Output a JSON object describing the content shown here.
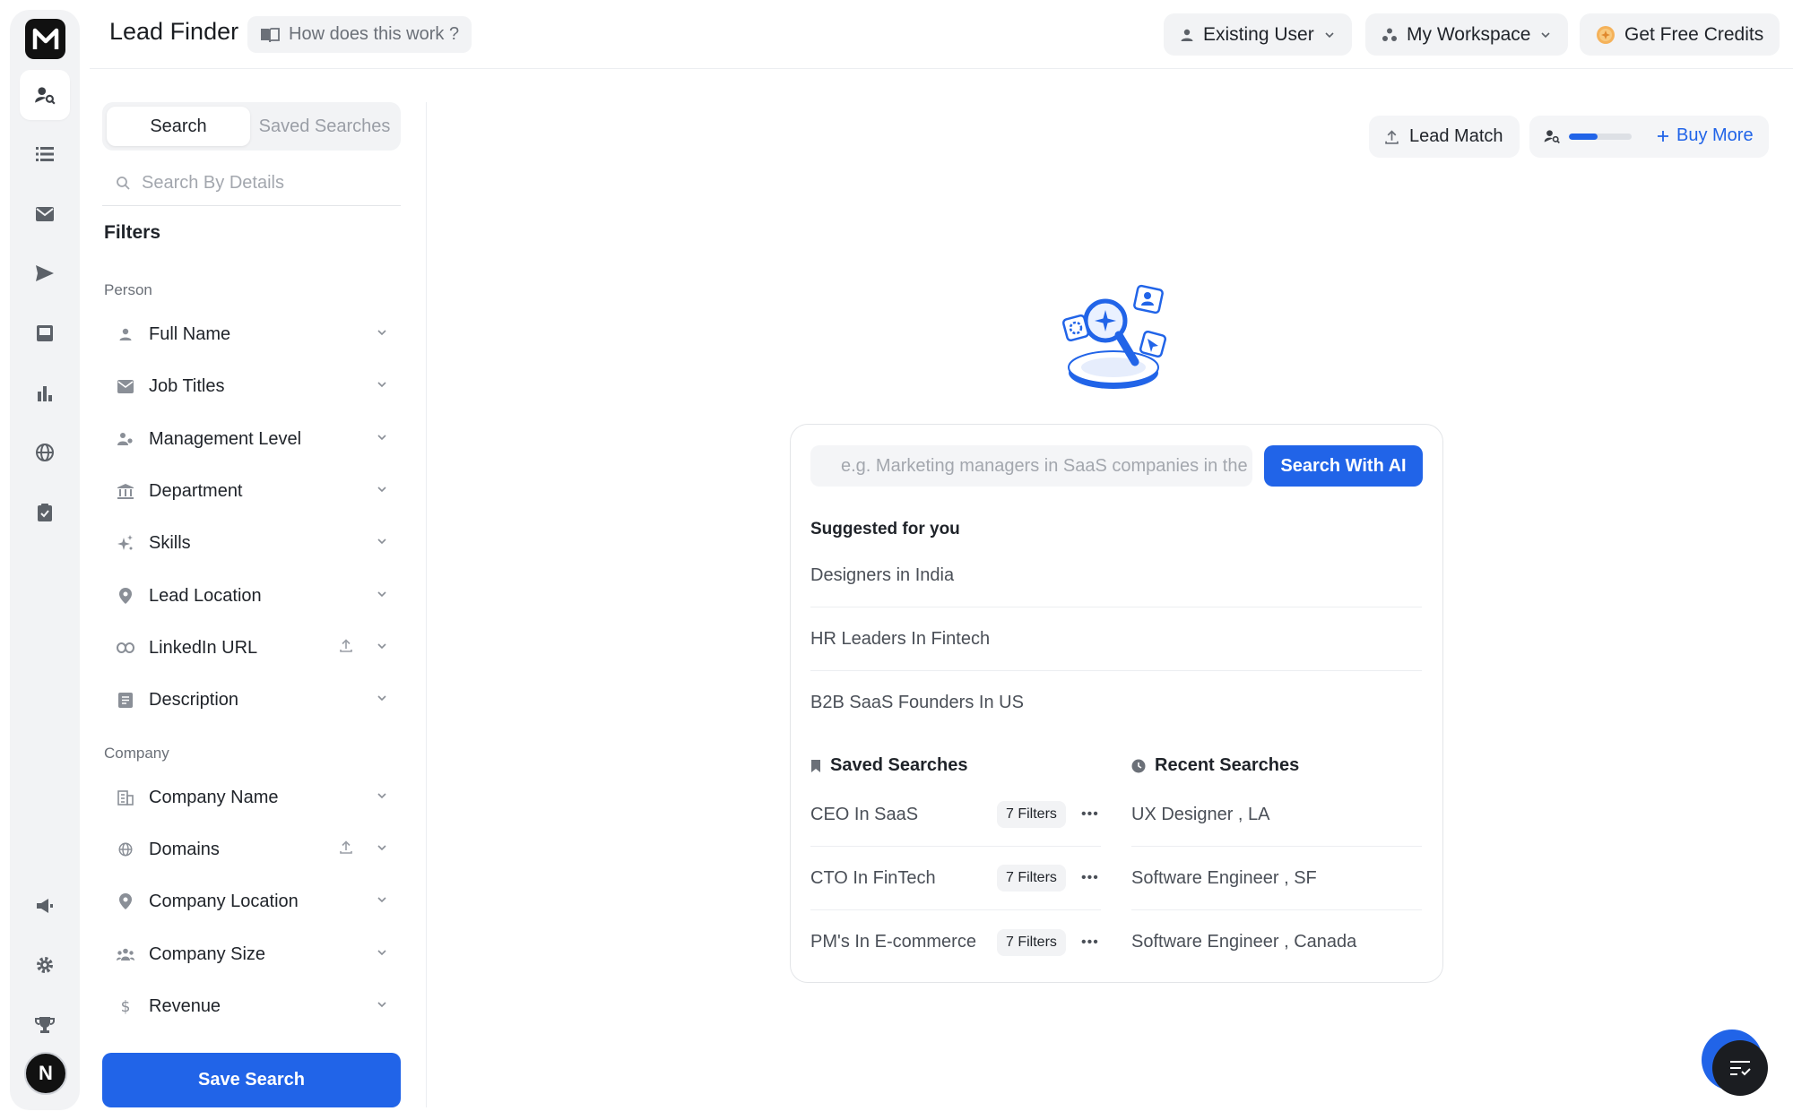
{
  "app": {
    "logo_letter": "M",
    "avatar_letter": "N"
  },
  "header": {
    "title": "Lead Finder",
    "how_label": "How does this work ?",
    "user_label": "Existing User",
    "workspace_label": "My Workspace",
    "credits_label": "Get Free Credits"
  },
  "left": {
    "tabs": [
      "Search",
      "Saved Searches"
    ],
    "active_tab": "Search",
    "search_placeholder": "Search By Details",
    "filters_title": "Filters",
    "person_label": "Person",
    "company_label": "Company",
    "person_filters": [
      {
        "label": "Full Name",
        "icon": "person-icon"
      },
      {
        "label": "Job Titles",
        "icon": "mail-icon"
      },
      {
        "label": "Management Level",
        "icon": "org-icon"
      },
      {
        "label": "Department",
        "icon": "building-columns-icon"
      },
      {
        "label": "Skills",
        "icon": "sparkle-icon"
      },
      {
        "label": "Lead Location",
        "icon": "location-pin-icon"
      },
      {
        "label": "LinkedIn URL",
        "icon": "link-icon",
        "upload": true
      },
      {
        "label": "Description",
        "icon": "document-icon"
      }
    ],
    "company_filters": [
      {
        "label": "Company Name",
        "icon": "company-building-icon"
      },
      {
        "label": "Domains",
        "icon": "globe-icon",
        "upload": true
      },
      {
        "label": "Company Location",
        "icon": "location-pin-icon"
      },
      {
        "label": "Company Size",
        "icon": "people-group-icon"
      },
      {
        "label": "Revenue",
        "icon": "dollar-icon"
      }
    ],
    "save_button": "Save Search"
  },
  "actions": {
    "lead_match": "Lead Match",
    "credit_progress": 0.45,
    "buy_more": "Buy More"
  },
  "main": {
    "ai_placeholder": "e.g. Marketing managers in SaaS companies in the US",
    "ai_button": "Search With AI",
    "suggested_title": "Suggested for you",
    "suggestions": [
      "Designers in India",
      "HR Leaders In Fintech",
      "B2B SaaS Founders In US"
    ],
    "saved_title": "Saved Searches",
    "saved": [
      {
        "name": "CEO In SaaS",
        "filters": "7 Filters"
      },
      {
        "name": "CTO In FinTech",
        "filters": "7 Filters"
      },
      {
        "name": "PM's In E-commerce",
        "filters": "7 Filters"
      }
    ],
    "recent_title": "Recent Searches",
    "recent": [
      "UX Designer , LA",
      "Software Engineer , SF",
      "Software Engineer , Canada"
    ]
  },
  "colors": {
    "primary": "#2164e8",
    "rail_bg": "#f2f3f5",
    "text": "#1f2329"
  }
}
